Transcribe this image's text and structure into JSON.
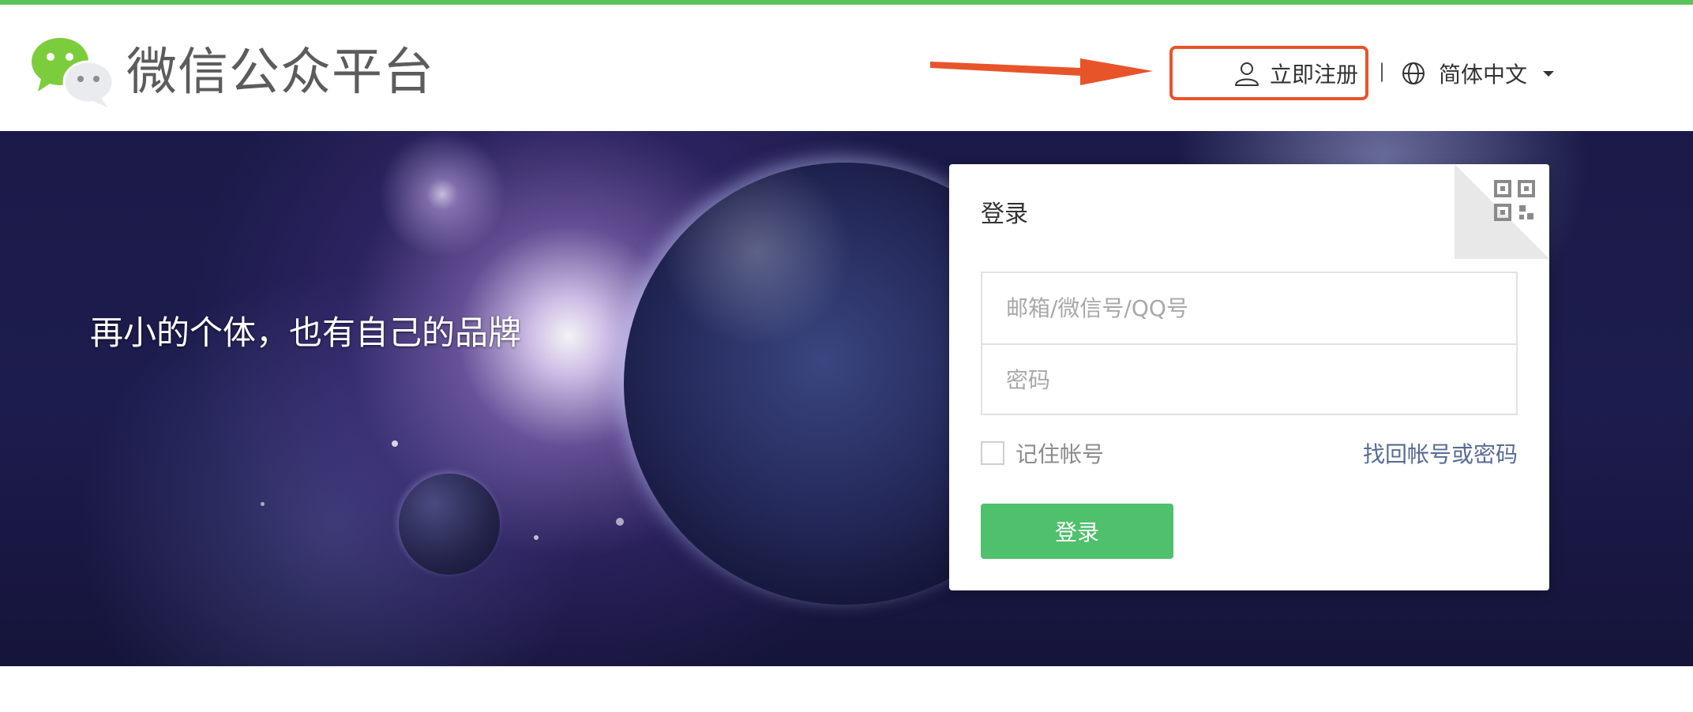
{
  "header": {
    "logo_text": "微信公众平台",
    "logo_icon": "wechat-logo-icon",
    "register_label": "立即注册",
    "register_icon": "user-icon",
    "separator": "|",
    "language_label": "简体中文",
    "language_icon": "globe-icon",
    "accent_color": "#5cc25c",
    "highlight_color": "#e8542a"
  },
  "banner": {
    "slogan": "再小的个体，也有自己的品牌"
  },
  "login": {
    "title": "登录",
    "qr_icon": "qr-code-icon",
    "account_placeholder": "邮箱/微信号/QQ号",
    "password_placeholder": "密码",
    "remember_label": "记住帐号",
    "forgot_label": "找回帐号或密码",
    "submit_label": "登录",
    "submit_color": "#4fc06c",
    "link_color": "#576b95"
  }
}
